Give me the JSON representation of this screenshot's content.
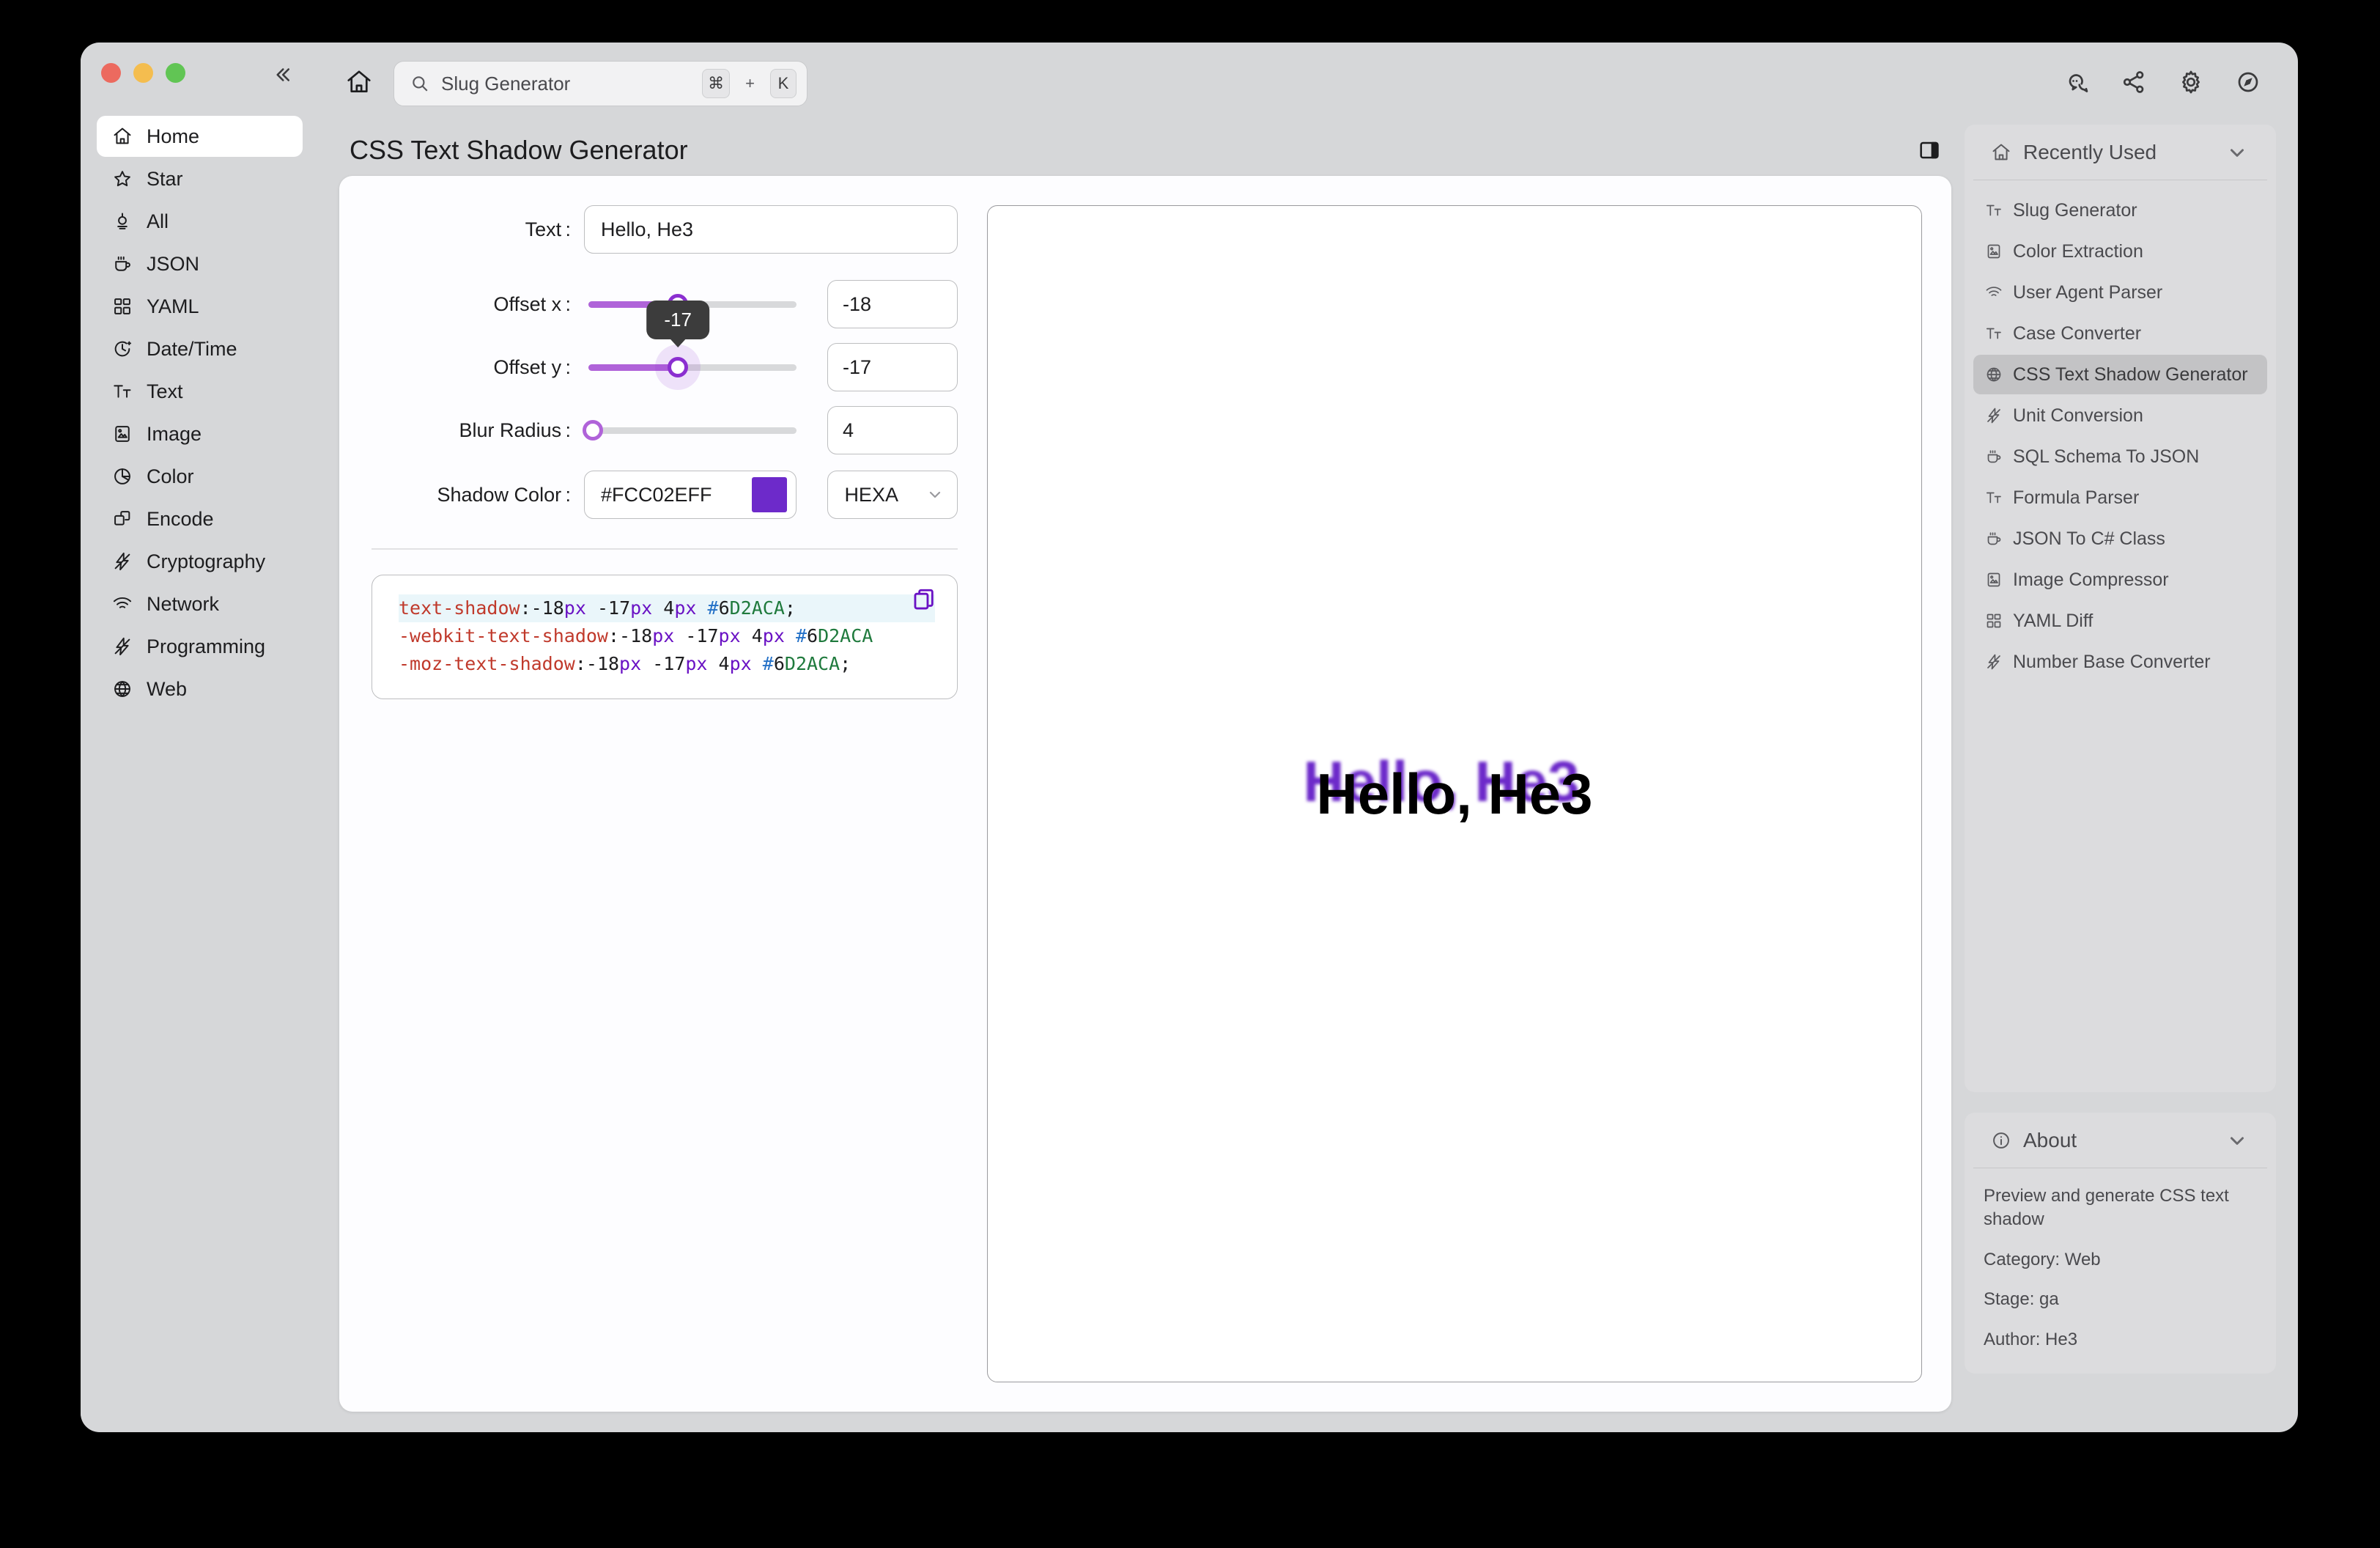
{
  "window": {
    "traffic_lights": [
      "close",
      "minimize",
      "maximize"
    ],
    "collapse_label": "«"
  },
  "topbar": {
    "home_icon": "home-icon",
    "search": {
      "value": "Slug Generator",
      "placeholder": "Search",
      "kbd_mod": "⌘",
      "kbd_plus": "+",
      "kbd_key": "K"
    },
    "icons": [
      "chat-icon",
      "share-icon",
      "gear-icon",
      "compass-icon"
    ]
  },
  "sidebar": {
    "items": [
      {
        "label": "Home",
        "icon": "home-icon",
        "active": true
      },
      {
        "label": "Star",
        "icon": "star-icon",
        "active": false
      },
      {
        "label": "All",
        "icon": "all-icon",
        "active": false
      },
      {
        "label": "JSON",
        "icon": "cup-icon",
        "active": false
      },
      {
        "label": "YAML",
        "icon": "grid-icon",
        "active": false
      },
      {
        "label": "Date/Time",
        "icon": "clock-icon",
        "active": false
      },
      {
        "label": "Text",
        "icon": "text-icon",
        "active": false
      },
      {
        "label": "Image",
        "icon": "image-icon",
        "active": false
      },
      {
        "label": "Color",
        "icon": "color-pie-icon",
        "active": false
      },
      {
        "label": "Encode",
        "icon": "encode-icon",
        "active": false
      },
      {
        "label": "Cryptography",
        "icon": "bolt-icon",
        "active": false
      },
      {
        "label": "Network",
        "icon": "wifi-icon",
        "active": false
      },
      {
        "label": "Programming",
        "icon": "bolt-icon",
        "active": false
      },
      {
        "label": "Web",
        "icon": "globe-icon",
        "active": false
      }
    ]
  },
  "page": {
    "title": "CSS Text Shadow Generator",
    "panel_toggle_icon": "right-panel-toggle-icon"
  },
  "form": {
    "text": {
      "label": "Text :",
      "value": "Hello, He3"
    },
    "offset_x": {
      "label": "Offset x :",
      "value": "-18",
      "slider_percent": 43
    },
    "offset_y": {
      "label": "Offset y :",
      "value": "-17",
      "slider_percent": 43,
      "tooltip": "-17"
    },
    "blur_radius": {
      "label": "Blur Radius :",
      "value": "4",
      "slider_percent": 2
    },
    "shadow_color": {
      "label": "Shadow Color :",
      "value": "#FCC02EFF",
      "swatch_hex": "#6D2ACA",
      "format": "HEXA"
    }
  },
  "code": {
    "copy_icon": "copy-icon",
    "lines": [
      {
        "highlight": true,
        "prop": "text-shadow",
        "x": "-18",
        "y": "-17",
        "blur": "4",
        "hex": "6D2ACA",
        "semi": ";"
      },
      {
        "highlight": false,
        "prop": "-webkit-text-shadow",
        "x": "-18",
        "y": "-17",
        "blur": "4",
        "hex": "6D2ACA",
        "semi": ""
      },
      {
        "highlight": false,
        "prop": "-moz-text-shadow",
        "x": "-18",
        "y": "-17",
        "blur": "4",
        "hex": "6D2ACA",
        "semi": ";"
      }
    ]
  },
  "preview": {
    "text": "Hello, He3",
    "shadow_css": "-18px -17px 4px #6D2ACA"
  },
  "recently_used": {
    "title": "Recently Used",
    "lead_icon": "home-icon",
    "chevron": "chevron-down-icon",
    "items": [
      {
        "label": "Slug Generator",
        "icon": "text-icon",
        "active": false
      },
      {
        "label": "Color Extraction",
        "icon": "image-icon",
        "active": false
      },
      {
        "label": "User Agent Parser",
        "icon": "wifi-icon",
        "active": false
      },
      {
        "label": "Case Converter",
        "icon": "text-icon",
        "active": false
      },
      {
        "label": "CSS Text Shadow Generator",
        "icon": "globe-icon",
        "active": true
      },
      {
        "label": "Unit Conversion",
        "icon": "bolt-icon",
        "active": false
      },
      {
        "label": "SQL Schema To JSON",
        "icon": "cup-icon",
        "active": false
      },
      {
        "label": "Formula Parser",
        "icon": "text-icon",
        "active": false
      },
      {
        "label": "JSON To C# Class",
        "icon": "cup-icon",
        "active": false
      },
      {
        "label": "Image Compressor",
        "icon": "image-icon",
        "active": false
      },
      {
        "label": "YAML Diff",
        "icon": "grid-icon",
        "active": false
      },
      {
        "label": "Number Base Converter",
        "icon": "bolt-icon",
        "active": false
      }
    ]
  },
  "about": {
    "title": "About",
    "lead_icon": "info-icon",
    "chevron": "chevron-down-icon",
    "description": "Preview and generate CSS text shadow",
    "category": "Category: Web",
    "stage": "Stage: ga",
    "author": "Author: He3"
  }
}
